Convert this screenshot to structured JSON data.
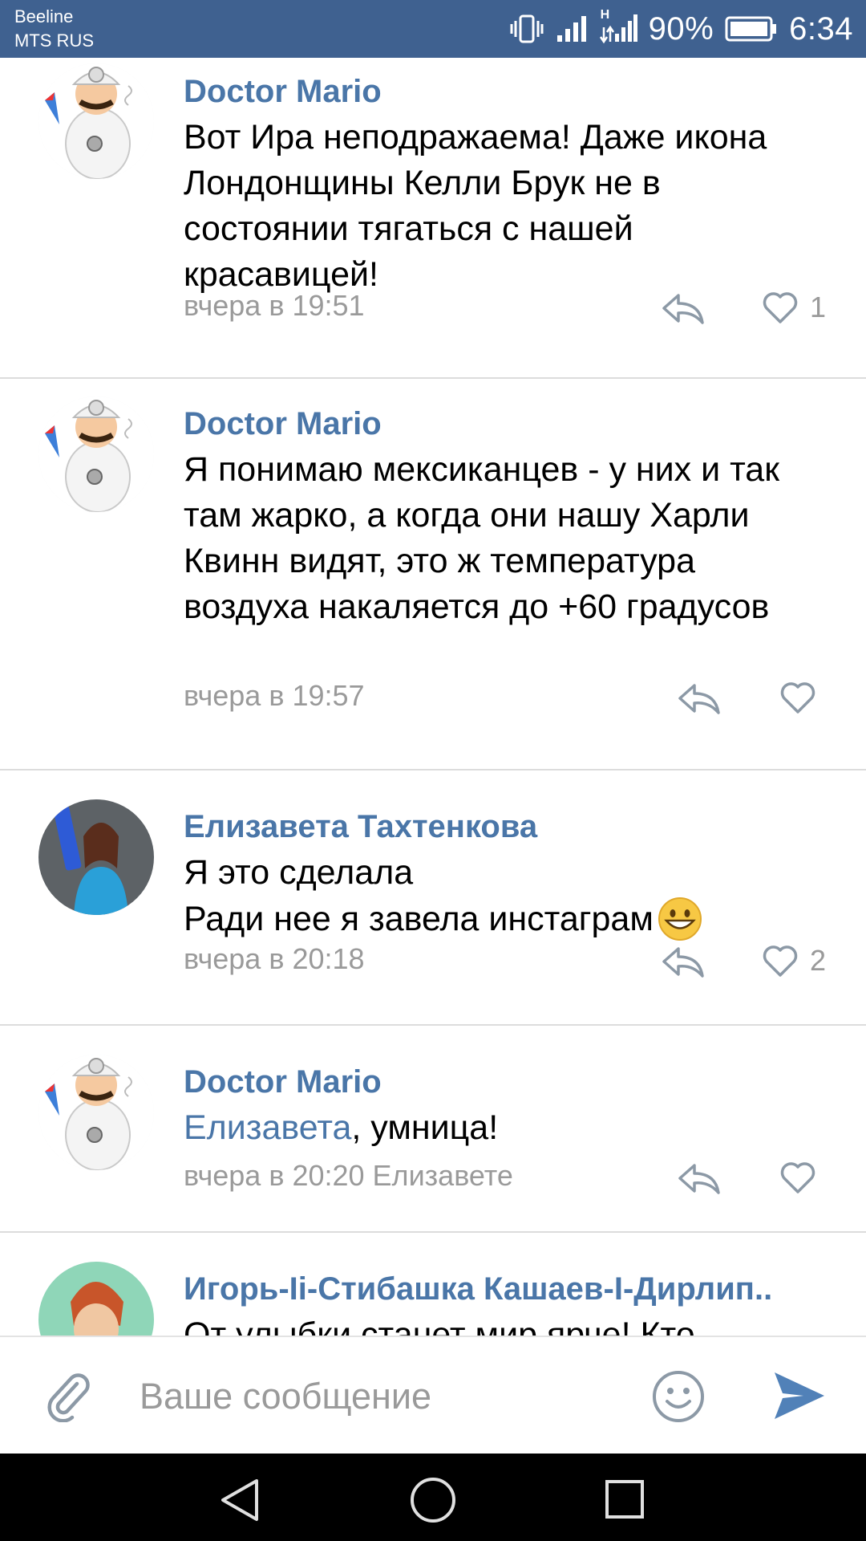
{
  "status_bar": {
    "carrier_1": "Beeline",
    "carrier_2": "MTS RUS",
    "network_label": "H",
    "battery_percent": "90%",
    "time": "6:34"
  },
  "comments": [
    {
      "author": "Doctor Mario",
      "text": "Вот Ира неподражаема! Даже икона Лондонщины Келли Брук не в состоянии тягаться с нашей красавицей!",
      "time": "вчера в 19:51",
      "likes": "1",
      "avatar_icon": "doctor-mario-avatar"
    },
    {
      "author": "Doctor Mario",
      "text": "Я понимаю мексиканцев - у них и так там жарко, а когда они нашу Харли Квинн видят, это ж температура воздуха накаляется до +60 градусов",
      "time": "вчера в 19:57",
      "likes": "",
      "avatar_icon": "doctor-mario-avatar"
    },
    {
      "author": "Елизавета Тахтенкова",
      "text_line_1": "Я это сделала",
      "text_line_2": "Ради нее я завела инстаграм",
      "emoji": "grinning-face",
      "time": "вчера в 20:18",
      "likes": "2",
      "avatar_icon": "user-photo-avatar"
    },
    {
      "author": "Doctor Mario",
      "mention": "Елизавета",
      "text_rest": ", умница!",
      "time": "вчера в 20:20 Елизавете",
      "likes": "",
      "avatar_icon": "doctor-mario-avatar"
    },
    {
      "author": "Игорь-Ii-Стибашка Кашаев-I-Дирлип..",
      "text": "От улыбки станет мир ярче! Кто",
      "avatar_icon": "cartoon-avatar"
    }
  ],
  "composer": {
    "placeholder": "Ваше сообщение",
    "attach_icon": "paperclip-icon",
    "emoji_icon": "smiley-icon",
    "send_icon": "send-icon"
  },
  "colors": {
    "status_bar": "#3f6190",
    "link_blue": "#4a76a8",
    "meta_gray": "#9a9a9a",
    "send_blue": "#5181b8"
  }
}
